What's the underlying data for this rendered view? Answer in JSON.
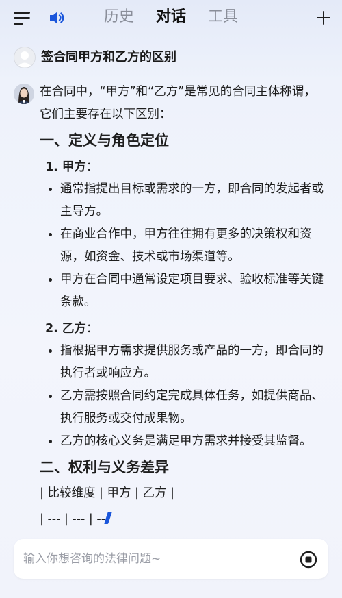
{
  "header": {
    "tabs": [
      {
        "label": "历史"
      },
      {
        "label": "对话"
      },
      {
        "label": "工具"
      }
    ]
  },
  "question": "签合同甲方和乙方的区别",
  "answer": {
    "intro": "在合同中，“甲方”和“乙方”是常见的合同主体称谓，它们主要存在以下区别：",
    "section1": {
      "title": "一、定义与角色定位",
      "party_a": {
        "label": "1. 甲方",
        "suffix": "：",
        "bullets": [
          "通常指提出目标或需求的一方，即合同的发起者或主导方。",
          "在商业合作中，甲方往往拥有更多的决策权和资源，如资金、技术或市场渠道等。",
          "甲方在合同中通常设定项目要求、验收标准等关键条款。"
        ]
      },
      "party_b": {
        "label": "2. 乙方",
        "suffix": "：",
        "bullets": [
          "指根据甲方需求提供服务或产品的一方，即合同的执行者或响应方。",
          "乙方需按照合同约定完成具体任务，如提供商品、执行服务或交付成果物。",
          "乙方的核心义务是满足甲方需求并接受其监督。"
        ]
      }
    },
    "section2": {
      "title": "二、权利与义务差异",
      "table_header": "| 比较维度 | 甲方 | 乙方 |",
      "table_sep": "| --- | --- | --"
    }
  },
  "input": {
    "placeholder": "输入你想咨询的法律问题~"
  },
  "colors": {
    "accent": "#1a56db",
    "active_tab": "#111111",
    "inactive_tab": "#8a8e99"
  },
  "icons": [
    "menu-icon",
    "speaker-icon",
    "plus-icon",
    "user-avatar",
    "bot-avatar",
    "stop-icon"
  ]
}
